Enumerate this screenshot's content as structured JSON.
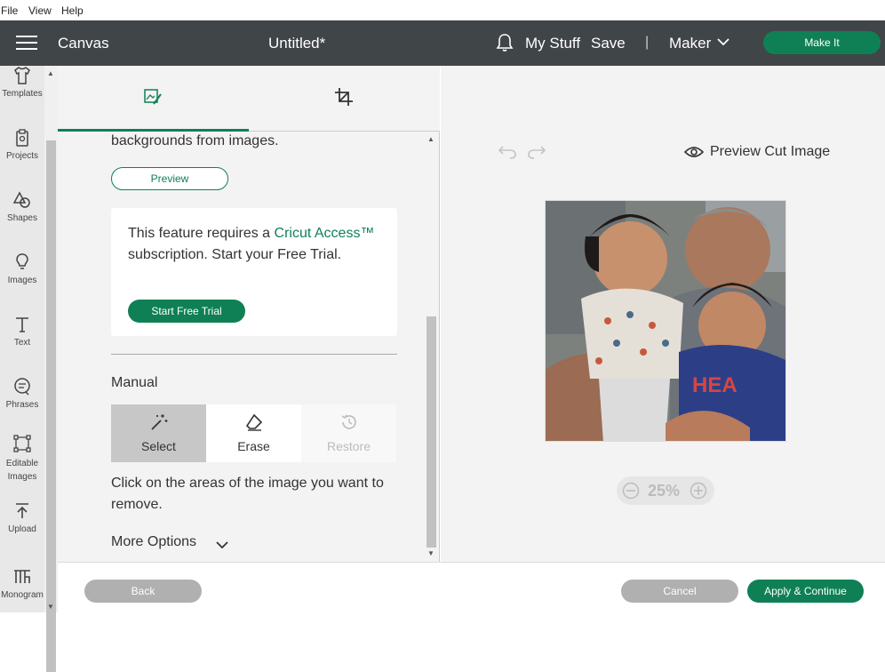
{
  "menu": {
    "file": "File",
    "view": "View",
    "help": "Help"
  },
  "header": {
    "section": "Canvas",
    "doc_title": "Untitled*",
    "my_stuff": "My Stuff",
    "save": "Save",
    "separator": "|",
    "machine": "Maker",
    "make_it": "Make It"
  },
  "sidebar": {
    "items": [
      {
        "label": "Templates",
        "icon": "shirt-icon"
      },
      {
        "label": "Projects",
        "icon": "clipboard-icon"
      },
      {
        "label": "Shapes",
        "icon": "shapes-icon"
      },
      {
        "label": "Images",
        "icon": "lightbulb-icon"
      },
      {
        "label": "Text",
        "icon": "text-icon"
      },
      {
        "label": "Phrases",
        "icon": "speech-bubble-icon"
      },
      {
        "label": "Editable Images",
        "icon": "edit-nodes-icon"
      },
      {
        "label": "Upload",
        "icon": "upload-icon"
      },
      {
        "label": "Monogram",
        "icon": "monogram-icon"
      }
    ]
  },
  "panel": {
    "description": "backgrounds from images.",
    "preview_button": "Preview",
    "notice": {
      "text_before": "This feature requires a ",
      "link": "Cricut Access™",
      "text_after": " subscription. Start your Free Trial.",
      "button": "Start Free Trial"
    },
    "manual_heading": "Manual",
    "tools": {
      "select": "Select",
      "erase": "Erase",
      "restore": "Restore"
    },
    "hint": "Click on the areas of the image you want to remove.",
    "more_options": "More Options"
  },
  "canvas": {
    "preview_cut": "Preview Cut Image",
    "zoom": "25%"
  },
  "footer": {
    "back": "Back",
    "cancel": "Cancel",
    "apply": "Apply & Continue"
  },
  "colors": {
    "accent": "#0f8055",
    "topbar": "#404548"
  }
}
